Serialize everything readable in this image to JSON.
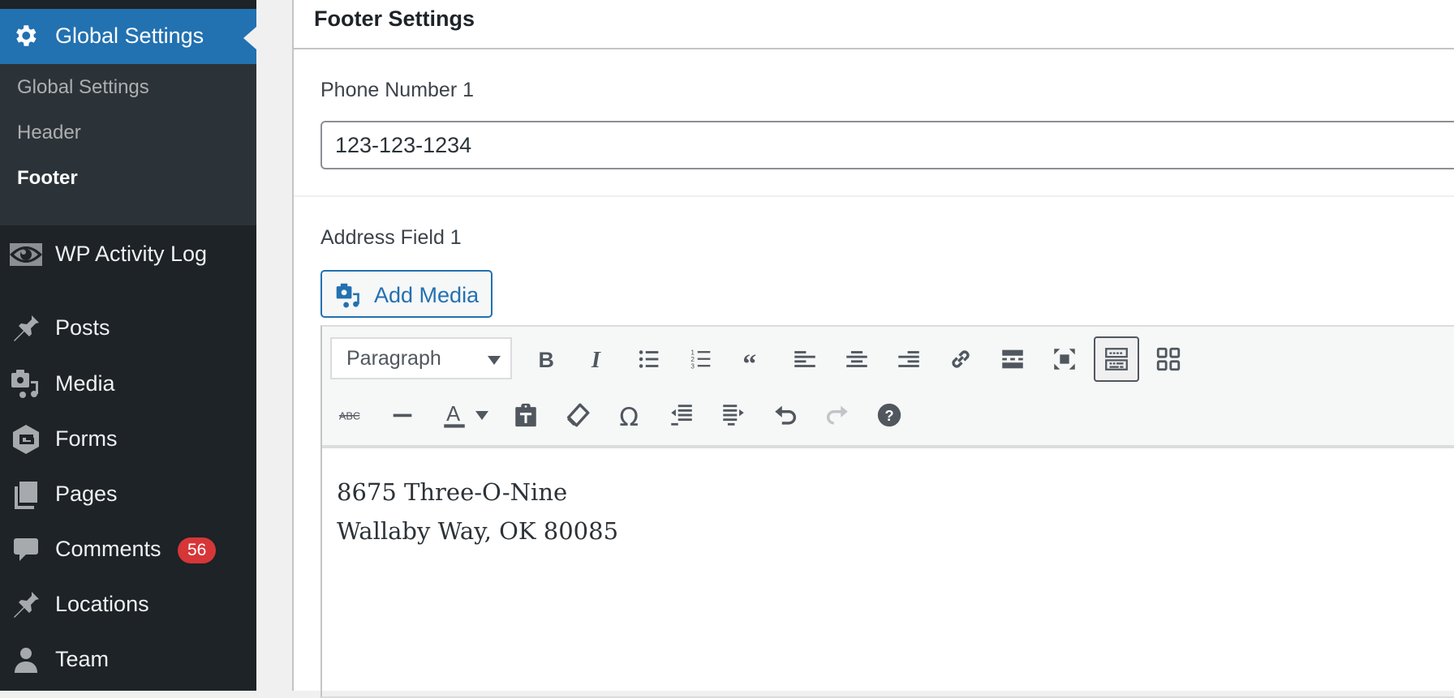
{
  "sidebar": {
    "active_menu": {
      "label": "Global Settings",
      "icon": "gear-icon"
    },
    "submenu": [
      {
        "label": "Global Settings",
        "current": false
      },
      {
        "label": "Header",
        "current": false
      },
      {
        "label": "Footer",
        "current": true
      }
    ],
    "items": [
      {
        "label": "WP Activity Log",
        "icon": "eye-icon"
      },
      {
        "label": "Posts",
        "icon": "pushpin-icon"
      },
      {
        "label": "Media",
        "icon": "media-icon"
      },
      {
        "label": "Forms",
        "icon": "gravity-forms-icon"
      },
      {
        "label": "Pages",
        "icon": "pages-icon"
      },
      {
        "label": "Comments",
        "icon": "comment-icon",
        "badge": "56"
      },
      {
        "label": "Locations",
        "icon": "pushpin-icon"
      },
      {
        "label": "Team",
        "icon": "person-icon"
      }
    ]
  },
  "panel": {
    "title": "Footer Settings",
    "phone": {
      "label": "Phone Number 1",
      "value": "123-123-1234"
    },
    "address": {
      "label": "Address Field 1",
      "add_media_label": "Add Media",
      "format_select": "Paragraph",
      "toolbar_row1": [
        "bold",
        "italic",
        "bulleted-list",
        "numbered-list",
        "blockquote",
        "align-left",
        "align-center",
        "align-right",
        "insert-link",
        "read-more",
        "fullscreen",
        "toolbar-toggle",
        "blocks"
      ],
      "toolbar_row2": [
        "strikethrough",
        "horizontal-line",
        "text-color",
        "text-color-dropdown",
        "paste-as-text",
        "clear-formatting",
        "special-character",
        "decrease-indent",
        "increase-indent",
        "undo",
        "redo",
        "keyboard-shortcuts"
      ],
      "content_lines": [
        "8675 Three-O-Nine",
        "Wallaby Way, OK 80085"
      ]
    }
  },
  "colors": {
    "accent": "#2271b1",
    "sidebar": "#1d2327",
    "submenu": "#2c3338",
    "badge": "#d63638",
    "icon": "#50575e"
  }
}
